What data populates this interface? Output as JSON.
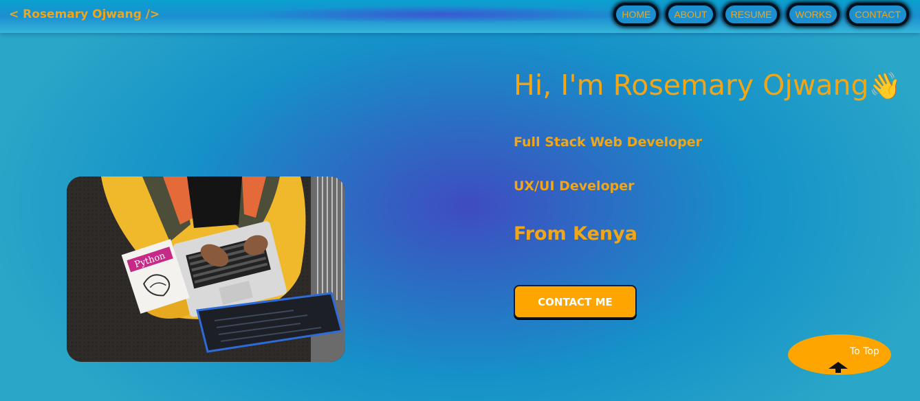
{
  "header": {
    "brand": "< Rosemary Ojwang />",
    "nav": [
      {
        "label": "HOME"
      },
      {
        "label": "ABOUT"
      },
      {
        "label": "RESUME"
      },
      {
        "label": "WORKS"
      },
      {
        "label": "CONTACT"
      }
    ]
  },
  "hero": {
    "greeting": "Hi, I'm Rosemary Ojwang",
    "wave_emoji": "👋",
    "role_primary": "Full Stack Web Developer",
    "role_secondary": "UX/UI Developer",
    "location": "From Kenya",
    "contact_button": "CONTACT ME",
    "image_book_text": "Python"
  },
  "to_top": {
    "label": "To Top",
    "icon": "arrow-up-icon"
  },
  "colors": {
    "accent": "#f1a617",
    "button": "#ffa500",
    "header_bg": "#1b8fd0",
    "nav_border": "#03101d"
  }
}
